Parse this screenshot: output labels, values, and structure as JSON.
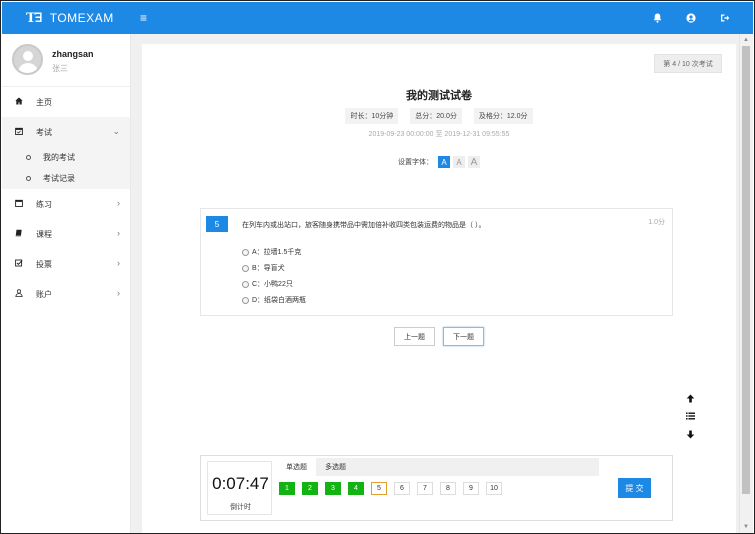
{
  "brand": {
    "logo": "T∃",
    "name": "TOMEXAM"
  },
  "user": {
    "username": "zhangsan",
    "realname": "张三"
  },
  "menu": {
    "home": "主页",
    "exam": "考试",
    "exam_sub": [
      "我的考试",
      "考试记录"
    ],
    "practice": "练习",
    "course": "课程",
    "vote": "投票",
    "account": "账户"
  },
  "exam": {
    "attempt_badge": "第 4 / 10 次考试",
    "title": "我的测试试卷",
    "duration": "时长：10分钟",
    "total_score": "总分：20.0分",
    "pass_score": "及格分：12.0分",
    "time_range": "2019-09-23 00:00:00 至 2019-12-31 09:55:55",
    "font_label": "设置字体：",
    "font_options": [
      "A",
      "A",
      "A"
    ]
  },
  "question": {
    "number": "5",
    "text": "在列车内或出站口，旅客随身携带品中需加倍补收四类包装运费的物品是（ ）。",
    "score": "1.0分",
    "options": [
      "A：拉墙1.5千克",
      "B：导盲犬",
      "C：小鸭22只",
      "D：纸袋白酒两瓶"
    ]
  },
  "nav": {
    "prev": "上一题",
    "next": "下一题"
  },
  "sheet": {
    "timer": "0:07:47",
    "timer_label": "倒计时",
    "tabs": [
      "单选题",
      "多选题"
    ],
    "boxes": [
      "1",
      "2",
      "3",
      "4",
      "5",
      "6",
      "7",
      "8",
      "9",
      "10"
    ],
    "answered_count": 4,
    "current": 5,
    "submit": "提 交"
  },
  "colors": {
    "primary": "#1e88e5",
    "answered": "#13b313",
    "current_border": "#e0a030"
  }
}
